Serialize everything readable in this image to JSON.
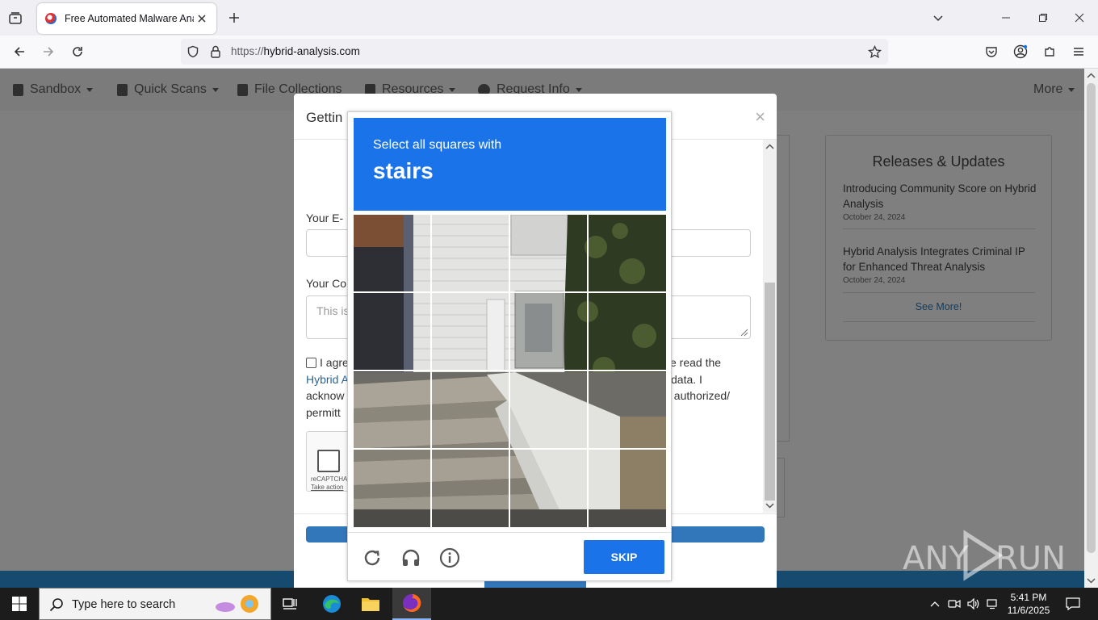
{
  "browser": {
    "tab_title": "Free Automated Malware Analy",
    "url_protocol": "https://",
    "url_host": "hybrid-analysis.com"
  },
  "site_nav": {
    "items": [
      "Sandbox",
      "Quick Scans",
      "File Collections",
      "Resources",
      "Request Info"
    ],
    "more": "More"
  },
  "releases": {
    "heading": "Releases & Updates",
    "items": [
      {
        "title": "Introducing Community Score on Hybrid Analysis",
        "date": "October 24, 2024"
      },
      {
        "title": "Hybrid Analysis Integrates Criminal IP for Enhanced Threat Analysis",
        "date": "October 24, 2024"
      }
    ],
    "see_more": "See More!"
  },
  "modal": {
    "title": "Gettin",
    "close": "×",
    "email_label": "Your E-",
    "comment_label": "Your Co",
    "comment_placeholder": "This is",
    "agree_text_1": "I agre",
    "agree_text_1b": "ve read the",
    "agree_link": "Hybrid A",
    "agree_text_2": "data. I",
    "agree_text_3": "acknow",
    "agree_text_3b": "t authorized/",
    "agree_text_4": "permitt",
    "recaptcha_text": "reCAPTCHA",
    "recaptcha_action": "Take action"
  },
  "captcha": {
    "instruction": "Select all squares with",
    "target": "stairs",
    "skip_label": "SKIP",
    "icons": [
      "reload-icon",
      "audio-icon",
      "info-icon"
    ]
  },
  "watermark": "ANY RUN",
  "taskbar": {
    "search_placeholder": "Type here to search",
    "time": "5:41 PM",
    "date": "11/6/2025"
  },
  "colors": {
    "captcha_blue": "#1a73e8",
    "site_blue": "#3377bb",
    "taskbar": "#1c1c1c"
  }
}
